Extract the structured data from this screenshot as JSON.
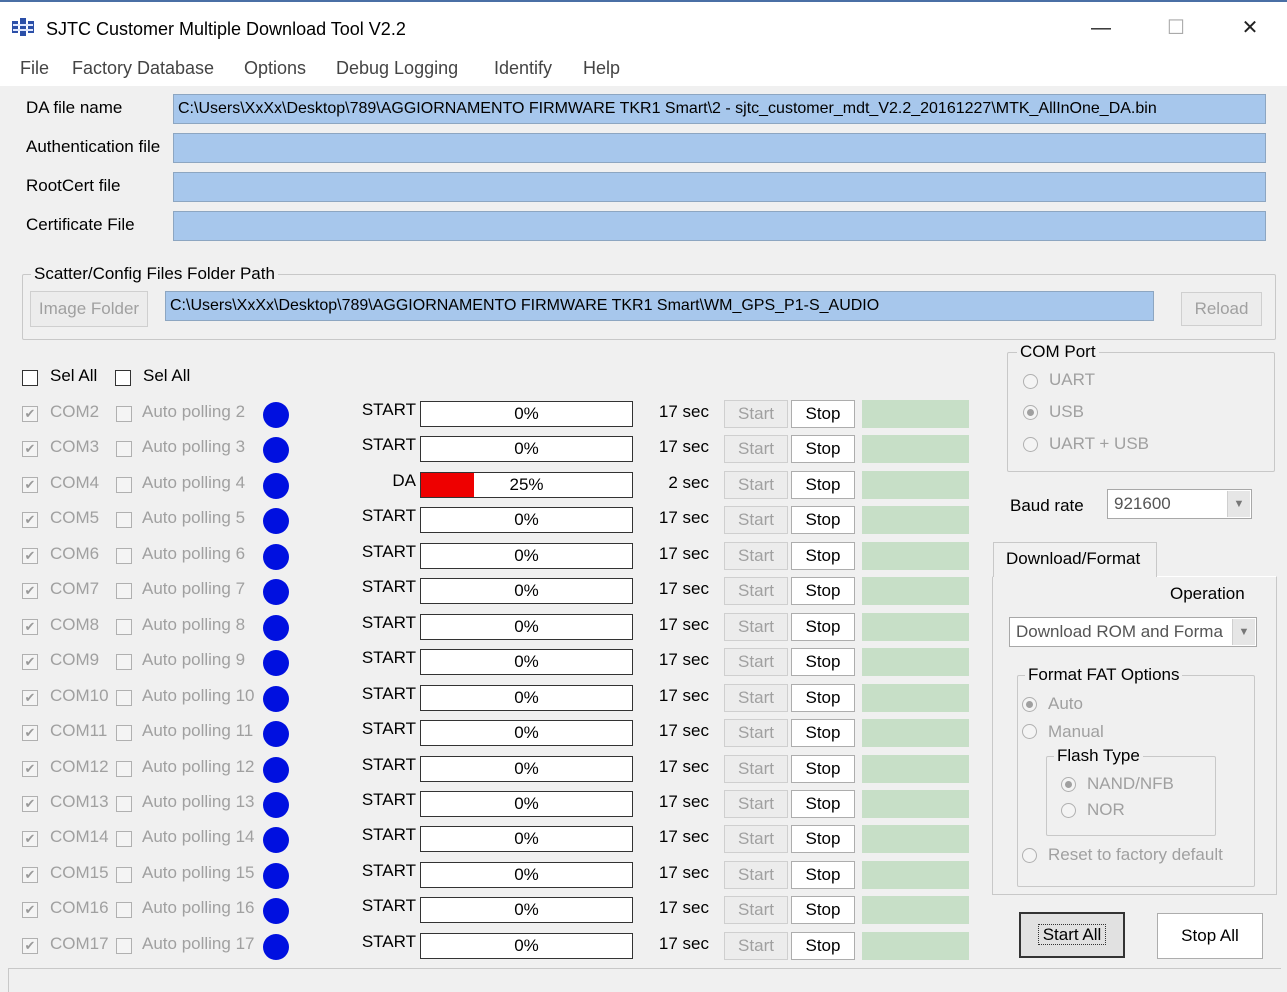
{
  "window": {
    "title": "SJTC Customer Multiple Download Tool V2.2",
    "minimize": "—",
    "maximize": "☐",
    "close": "✕"
  },
  "menu": [
    "File",
    "Factory Database",
    "Options",
    "Debug Logging",
    "Identify",
    "Help"
  ],
  "files": {
    "da_label": "DA file name",
    "da_value": "C:\\Users\\XxXx\\Desktop\\789\\AGGIORNAMENTO FIRMWARE TKR1 Smart\\2 - sjtc_customer_mdt_V2.2_20161227\\MTK_AllInOne_DA.bin",
    "auth_label": "Authentication file",
    "auth_value": "",
    "rootcert_label": "RootCert file",
    "rootcert_value": "",
    "cert_label": "Certificate File",
    "cert_value": ""
  },
  "scatter": {
    "group_label": "Scatter/Config Files Folder Path",
    "image_folder_button": "Image Folder",
    "path": "C:\\Users\\XxXx\\Desktop\\789\\AGGIORNAMENTO FIRMWARE TKR1 Smart\\WM_GPS_P1-S_AUDIO",
    "reload_button": "Reload"
  },
  "select_all": {
    "label1": "Sel All",
    "label2": "Sel All"
  },
  "ports": [
    {
      "com": "COM2",
      "poll": "Auto polling 2",
      "state": "START",
      "progress": 0,
      "progress_label": "0%",
      "time": "17 sec"
    },
    {
      "com": "COM3",
      "poll": "Auto polling 3",
      "state": "START",
      "progress": 0,
      "progress_label": "0%",
      "time": "17 sec"
    },
    {
      "com": "COM4",
      "poll": "Auto polling 4",
      "state": "DA",
      "progress": 25,
      "progress_label": "25%",
      "time": "2 sec"
    },
    {
      "com": "COM5",
      "poll": "Auto polling 5",
      "state": "START",
      "progress": 0,
      "progress_label": "0%",
      "time": "17 sec"
    },
    {
      "com": "COM6",
      "poll": "Auto polling 6",
      "state": "START",
      "progress": 0,
      "progress_label": "0%",
      "time": "17 sec"
    },
    {
      "com": "COM7",
      "poll": "Auto polling 7",
      "state": "START",
      "progress": 0,
      "progress_label": "0%",
      "time": "17 sec"
    },
    {
      "com": "COM8",
      "poll": "Auto polling 8",
      "state": "START",
      "progress": 0,
      "progress_label": "0%",
      "time": "17 sec"
    },
    {
      "com": "COM9",
      "poll": "Auto polling 9",
      "state": "START",
      "progress": 0,
      "progress_label": "0%",
      "time": "17 sec"
    },
    {
      "com": "COM10",
      "poll": "Auto polling 10",
      "state": "START",
      "progress": 0,
      "progress_label": "0%",
      "time": "17 sec"
    },
    {
      "com": "COM11",
      "poll": "Auto polling 11",
      "state": "START",
      "progress": 0,
      "progress_label": "0%",
      "time": "17 sec"
    },
    {
      "com": "COM12",
      "poll": "Auto polling 12",
      "state": "START",
      "progress": 0,
      "progress_label": "0%",
      "time": "17 sec"
    },
    {
      "com": "COM13",
      "poll": "Auto polling 13",
      "state": "START",
      "progress": 0,
      "progress_label": "0%",
      "time": "17 sec"
    },
    {
      "com": "COM14",
      "poll": "Auto polling 14",
      "state": "START",
      "progress": 0,
      "progress_label": "0%",
      "time": "17 sec"
    },
    {
      "com": "COM15",
      "poll": "Auto polling 15",
      "state": "START",
      "progress": 0,
      "progress_label": "0%",
      "time": "17 sec"
    },
    {
      "com": "COM16",
      "poll": "Auto polling 16",
      "state": "START",
      "progress": 0,
      "progress_label": "0%",
      "time": "17 sec"
    },
    {
      "com": "COM17",
      "poll": "Auto polling 17",
      "state": "START",
      "progress": 0,
      "progress_label": "0%",
      "time": "17 sec"
    }
  ],
  "row_buttons": {
    "start": "Start",
    "stop": "Stop"
  },
  "colors": {
    "indicator": "#0010e0",
    "progress_fill": "#ee0000",
    "field_bg": "#a7c7ec",
    "status_box": "#c7dfc7"
  },
  "com_port": {
    "group_label": "COM Port",
    "options": [
      "UART",
      "USB",
      "UART + USB"
    ],
    "selected": "USB"
  },
  "baud": {
    "label": "Baud rate",
    "value": "921600"
  },
  "tabs": {
    "download_format": "Download/Format"
  },
  "operation": {
    "label": "Operation",
    "value": "Download ROM and Forma"
  },
  "format_fat": {
    "group_label": "Format FAT Options",
    "auto": "Auto",
    "manual": "Manual",
    "selected": "Auto",
    "flash_type": {
      "group_label": "Flash  Type",
      "nand": "NAND/NFB",
      "nor": "NOR",
      "selected": "NAND/NFB"
    },
    "reset_label": "Reset to factory default"
  },
  "actions": {
    "start_all": "Start All",
    "stop_all": "Stop All"
  }
}
